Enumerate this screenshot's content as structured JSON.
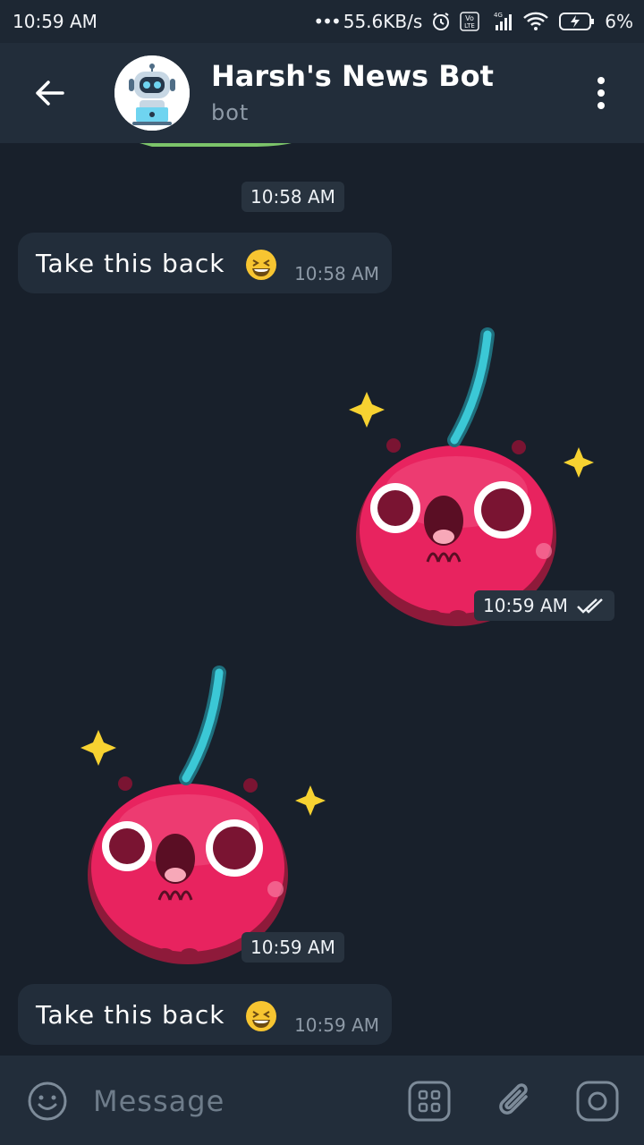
{
  "status": {
    "time": "10:59 AM",
    "speed": "55.6KB/s",
    "battery": "6%"
  },
  "header": {
    "title": "Harsh's News Bot",
    "subtitle": "bot"
  },
  "messages": [
    {
      "id": "m1",
      "kind": "sticker-partial",
      "time": "10:58 AM"
    },
    {
      "id": "m2",
      "kind": "text",
      "text": "Take this back",
      "emoji": "laughing-face",
      "time": "10:58 AM"
    },
    {
      "id": "m3",
      "kind": "sticker",
      "sticker": "cherry-surprised",
      "time": "10:59 AM",
      "read": true
    },
    {
      "id": "m4",
      "kind": "sticker",
      "sticker": "cherry-surprised",
      "time": "10:59 AM"
    },
    {
      "id": "m5",
      "kind": "text",
      "text": "Take this back",
      "emoji": "laughing-face",
      "time": "10:59 AM"
    }
  ],
  "input": {
    "placeholder": "Message"
  },
  "colors": {
    "background": "#18202b",
    "bar": "#222d3a",
    "bubble": "#222d3a",
    "muted": "#8e9aa7"
  }
}
